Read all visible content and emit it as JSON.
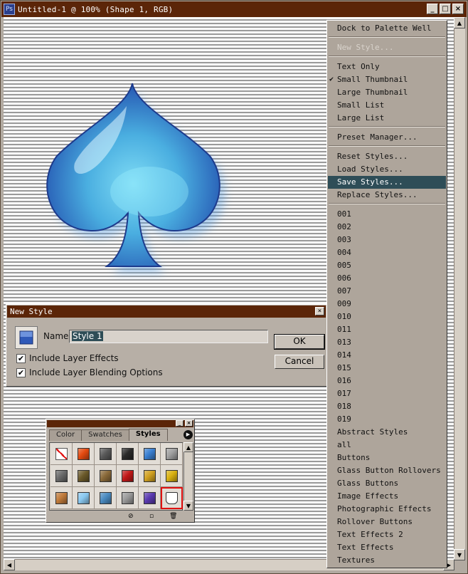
{
  "window": {
    "title": "Untitled-1 @ 100% (Shape 1, RGB)",
    "minimize": "_",
    "maximize": "□",
    "close": "×"
  },
  "dialog": {
    "title": "New Style",
    "close": "×",
    "name_label": "Name:",
    "name_value": "Style 1",
    "include_effects_label": "Include Layer Effects",
    "include_effects_checked": "✔",
    "include_blending_label": "Include Layer Blending Options",
    "include_blending_checked": "✔",
    "ok_label": "OK",
    "cancel_label": "Cancel"
  },
  "palette": {
    "tabs": [
      "Color",
      "Swatches",
      "Styles"
    ],
    "active_tab": "Styles",
    "menu_arrow": "▶",
    "swatches": [
      {
        "icon": "no-style-icon",
        "color": "#ffffff"
      },
      {
        "icon": "sun-burst-icon",
        "color": "#e44a10"
      },
      {
        "icon": "dark-square-icon",
        "color": "#5a5a5a"
      },
      {
        "icon": "camera-icon",
        "color": "#2a2a2a"
      },
      {
        "icon": "blue-bevel-icon",
        "color": "#3a7fd0"
      },
      {
        "icon": "gray-square-icon",
        "color": "#a0a0a0"
      },
      {
        "icon": "steel-icon",
        "color": "#6a6a6a"
      },
      {
        "icon": "olive-icon",
        "color": "#6b5a2a"
      },
      {
        "icon": "brown-icon",
        "color": "#8a6a3a"
      },
      {
        "icon": "red-button-icon",
        "color": "#c01818"
      },
      {
        "icon": "rainbow-icon",
        "color": "#d0a020"
      },
      {
        "icon": "gold-icon",
        "color": "#d8b010"
      },
      {
        "icon": "copper-icon",
        "color": "#c07a3a"
      },
      {
        "icon": "sky-glass-icon",
        "color": "#8ac8f0"
      },
      {
        "icon": "landscape-icon",
        "color": "#4a8ac0"
      },
      {
        "icon": "texture-icon",
        "color": "#9a9a9a"
      },
      {
        "icon": "purple-icon",
        "color": "#5a3ab0"
      },
      {
        "icon": "paint-bucket-icon",
        "color": "#ffffff"
      }
    ],
    "footer_delete_icon": "⊘",
    "footer_new_icon": "▫",
    "footer_trash_icon": "🗑"
  },
  "menu": {
    "items": [
      {
        "label": "Dock to Palette Well",
        "state": "normal"
      },
      {
        "label": "New Style...",
        "state": "disabled"
      },
      {
        "label": "Text Only",
        "state": "normal"
      },
      {
        "label": "Small Thumbnail",
        "state": "checked",
        "check": "✔"
      },
      {
        "label": "Large Thumbnail",
        "state": "normal"
      },
      {
        "label": "Small List",
        "state": "normal"
      },
      {
        "label": "Large List",
        "state": "normal"
      },
      {
        "label": "Preset Manager...",
        "state": "normal"
      },
      {
        "label": "Reset Styles...",
        "state": "normal"
      },
      {
        "label": "Load Styles...",
        "state": "normal"
      },
      {
        "label": "Save Styles...",
        "state": "highlighted"
      },
      {
        "label": "Replace Styles...",
        "state": "normal"
      },
      {
        "label": "001",
        "state": "normal"
      },
      {
        "label": "002",
        "state": "normal"
      },
      {
        "label": "003",
        "state": "normal"
      },
      {
        "label": "004",
        "state": "normal"
      },
      {
        "label": "005",
        "state": "normal"
      },
      {
        "label": "006",
        "state": "normal"
      },
      {
        "label": "007",
        "state": "normal"
      },
      {
        "label": "009",
        "state": "normal"
      },
      {
        "label": "010",
        "state": "normal"
      },
      {
        "label": "011",
        "state": "normal"
      },
      {
        "label": "013",
        "state": "normal"
      },
      {
        "label": "014",
        "state": "normal"
      },
      {
        "label": "015",
        "state": "normal"
      },
      {
        "label": "016",
        "state": "normal"
      },
      {
        "label": "017",
        "state": "normal"
      },
      {
        "label": "018",
        "state": "normal"
      },
      {
        "label": "019",
        "state": "normal"
      },
      {
        "label": "Abstract Styles",
        "state": "normal"
      },
      {
        "label": "all",
        "state": "normal"
      },
      {
        "label": "Buttons",
        "state": "normal"
      },
      {
        "label": "Glass Button Rollovers",
        "state": "normal"
      },
      {
        "label": "Glass Buttons",
        "state": "normal"
      },
      {
        "label": "Image Effects",
        "state": "normal"
      },
      {
        "label": "Photographic Effects",
        "state": "normal"
      },
      {
        "label": "Rollover Buttons",
        "state": "normal"
      },
      {
        "label": "Text Effects 2",
        "state": "normal"
      },
      {
        "label": "Text Effects",
        "state": "normal"
      },
      {
        "label": "Textures",
        "state": "normal"
      }
    ]
  }
}
